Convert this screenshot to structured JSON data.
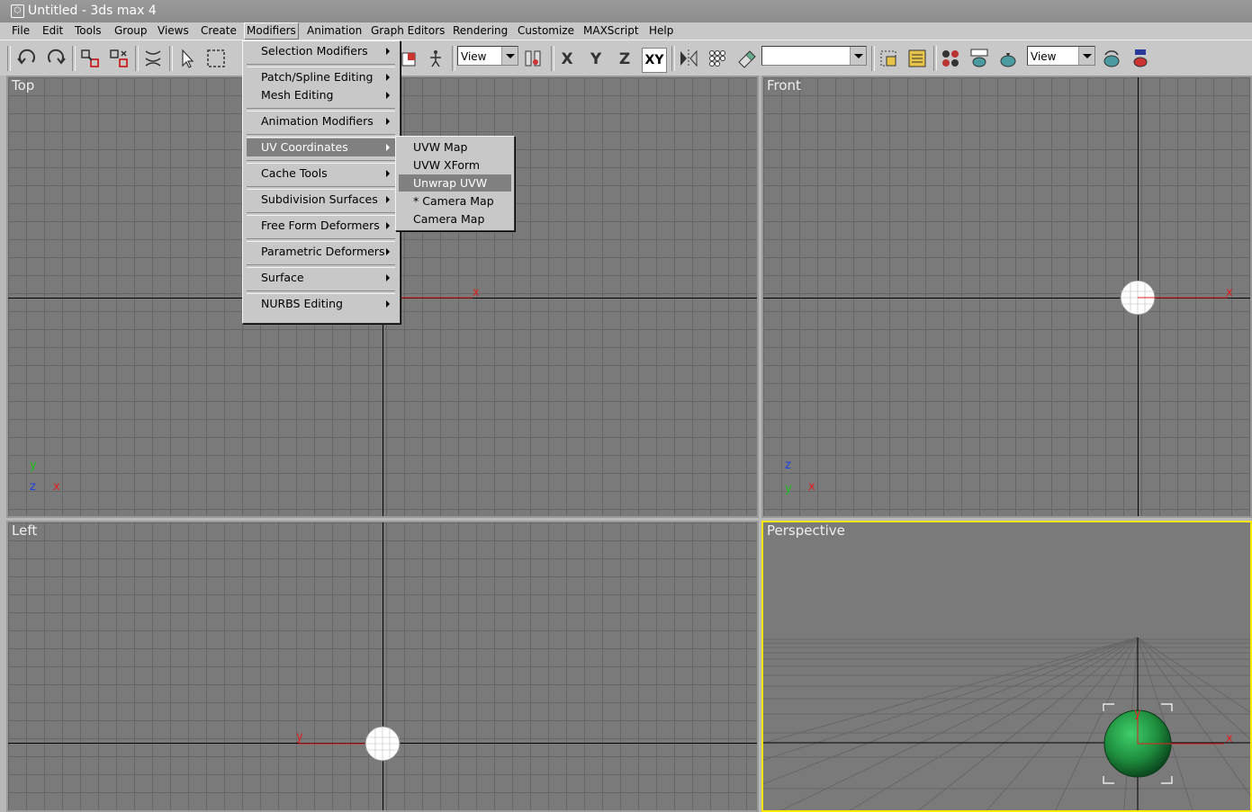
{
  "window": {
    "title": "Untitled - 3ds max 4"
  },
  "menubar": {
    "items": [
      "File",
      "Edit",
      "Tools",
      "Group",
      "Views",
      "Create",
      "Modifiers",
      "Animation",
      "Graph Editors",
      "Rendering",
      "Customize",
      "MAXScript",
      "Help"
    ],
    "active": "Modifiers"
  },
  "toolbar": {
    "view_combo": "View",
    "render_view_combo": "View",
    "selection_set_combo": "",
    "axis_buttons": [
      "X",
      "Y",
      "Z",
      "XY"
    ]
  },
  "modifiers_menu": {
    "items": [
      {
        "label": "Selection Modifiers"
      },
      {
        "label": "Patch/Spline Editing"
      },
      {
        "label": "Mesh Editing"
      },
      {
        "label": "Animation Modifiers"
      },
      {
        "label": "UV Coordinates",
        "highlighted": true
      },
      {
        "label": "Cache Tools"
      },
      {
        "label": "Subdivision Surfaces"
      },
      {
        "label": "Free Form Deformers"
      },
      {
        "label": "Parametric Deformers"
      },
      {
        "label": "Surface"
      },
      {
        "label": "NURBS Editing"
      }
    ]
  },
  "uv_submenu": {
    "items": [
      {
        "label": "UVW Map"
      },
      {
        "label": "UVW XForm"
      },
      {
        "label": "Unwrap UVW",
        "highlighted": true
      },
      {
        "label": "* Camera Map"
      },
      {
        "label": "Camera Map"
      }
    ]
  },
  "viewports": {
    "top": {
      "label": "Top",
      "axis_labels": {
        "y": "y",
        "z": "z",
        "x": "x"
      }
    },
    "front": {
      "label": "Front",
      "axis_labels": {
        "z": "z",
        "y": "y",
        "x": "x"
      }
    },
    "left": {
      "label": "Left"
    },
    "perspective": {
      "label": "Perspective"
    }
  },
  "gizmo_labels": {
    "x": "x",
    "y": "y",
    "z": "z"
  },
  "colors": {
    "active_viewport_border": "#ffe400",
    "x_axis": "#e02020",
    "y_axis": "#20c020",
    "z_axis": "#2040e0",
    "sphere": "#1f8f3f"
  }
}
